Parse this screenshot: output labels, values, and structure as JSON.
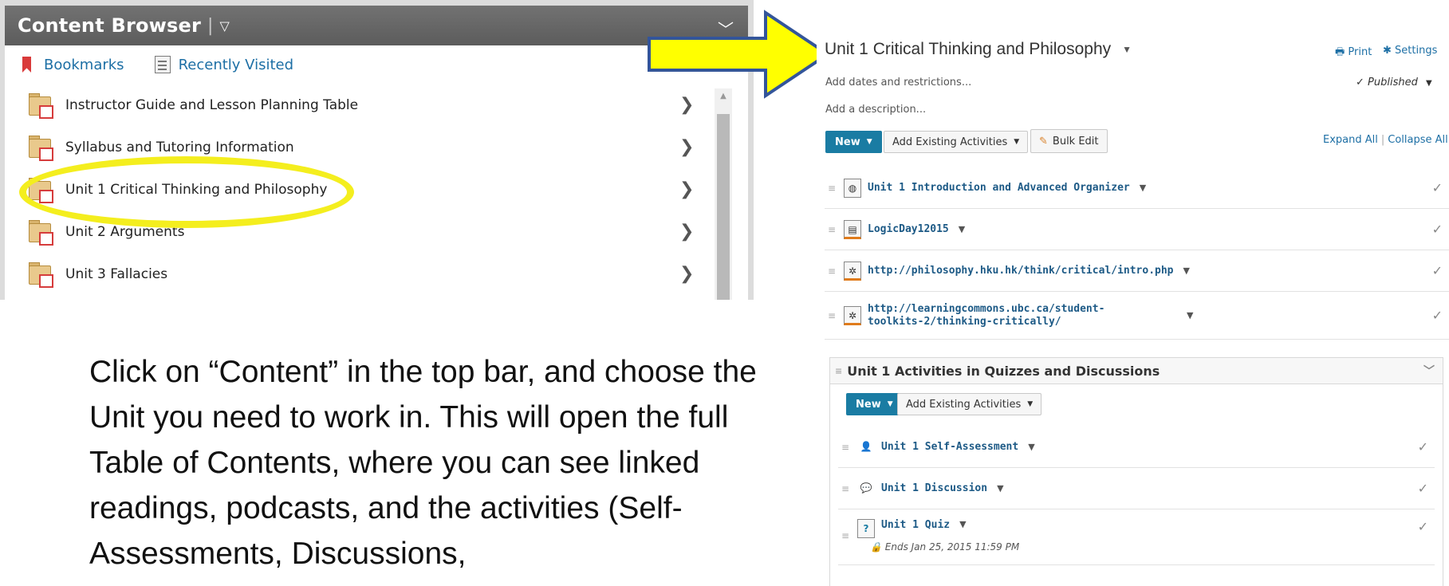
{
  "content_browser": {
    "title": "Content Browser",
    "separator": "|",
    "title_dropdown": "▽",
    "collapse_icon": "chevron-down-icon",
    "collapse_glyph": "﹀",
    "bookmarks_label": "Bookmarks",
    "recently_visited_label": "Recently Visited",
    "items": [
      {
        "label": "Instructor Guide and Lesson Planning Table"
      },
      {
        "label": "Syllabus and Tutoring Information"
      },
      {
        "label": "Unit 1 Critical Thinking and Philosophy"
      },
      {
        "label": "Unit 2 Arguments"
      },
      {
        "label": "Unit 3 Fallacies"
      }
    ],
    "highlight_color": "#f4ee1e"
  },
  "arrow": {
    "color": "#ffff00",
    "outline": "#33559a"
  },
  "caption": "Click on “Content” in the top bar, and choose the Unit you need to work in. This will open the full Table of Contents, where you can see linked readings, podcasts, and the activities (Self-Assessments, Discussions,",
  "toc": {
    "title": "Unit 1 Critical Thinking and Philosophy",
    "print_label": "Print",
    "settings_label": "Settings",
    "add_dates": "Add dates and restrictions...",
    "published": "Published",
    "add_description": "Add a description...",
    "new_label": "New",
    "add_existing_label": "Add Existing Activities",
    "bulk_edit_label": "Bulk Edit",
    "expand_all": "Expand All",
    "collapse_all": "Collapse All",
    "items": [
      {
        "title": "Unit 1 Introduction and Advanced Organizer",
        "icon": "globe-icon"
      },
      {
        "title": "LogicDay12015",
        "icon": "document-icon"
      },
      {
        "title": "http://philosophy.hku.hk/think/critical/intro.php",
        "icon": "link-icon"
      },
      {
        "title": "http://learningcommons.ubc.ca/student-toolkits-2/thinking-critically/",
        "icon": "link-icon"
      }
    ],
    "module": {
      "title": "Unit 1 Activities in Quizzes and Discussions",
      "new_label": "New",
      "add_existing_label": "Add Existing Activities",
      "items": [
        {
          "title": "Unit 1 Self-Assessment",
          "icon": "self-assessment-icon"
        },
        {
          "title": "Unit 1 Discussion",
          "icon": "discussion-icon"
        },
        {
          "title": "Unit 1 Quiz",
          "icon": "quiz-icon",
          "note": "Ends Jan 25, 2015 11:59 PM"
        }
      ]
    }
  },
  "colors": {
    "accent": "#1a7ca3",
    "link": "#1d6fa5",
    "header": "#6a6a6a"
  }
}
